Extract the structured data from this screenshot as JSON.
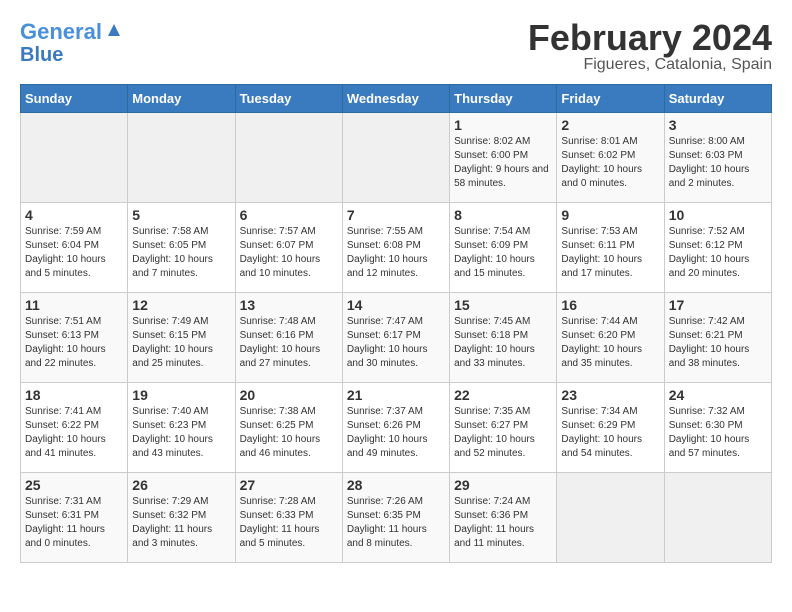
{
  "header": {
    "logo_line1": "General",
    "logo_line2": "Blue",
    "title": "February 2024",
    "subtitle": "Figueres, Catalonia, Spain"
  },
  "days_of_week": [
    "Sunday",
    "Monday",
    "Tuesday",
    "Wednesday",
    "Thursday",
    "Friday",
    "Saturday"
  ],
  "weeks": [
    [
      {
        "num": "",
        "info": ""
      },
      {
        "num": "",
        "info": ""
      },
      {
        "num": "",
        "info": ""
      },
      {
        "num": "",
        "info": ""
      },
      {
        "num": "1",
        "info": "Sunrise: 8:02 AM\nSunset: 6:00 PM\nDaylight: 9 hours and 58 minutes."
      },
      {
        "num": "2",
        "info": "Sunrise: 8:01 AM\nSunset: 6:02 PM\nDaylight: 10 hours and 0 minutes."
      },
      {
        "num": "3",
        "info": "Sunrise: 8:00 AM\nSunset: 6:03 PM\nDaylight: 10 hours and 2 minutes."
      }
    ],
    [
      {
        "num": "4",
        "info": "Sunrise: 7:59 AM\nSunset: 6:04 PM\nDaylight: 10 hours and 5 minutes."
      },
      {
        "num": "5",
        "info": "Sunrise: 7:58 AM\nSunset: 6:05 PM\nDaylight: 10 hours and 7 minutes."
      },
      {
        "num": "6",
        "info": "Sunrise: 7:57 AM\nSunset: 6:07 PM\nDaylight: 10 hours and 10 minutes."
      },
      {
        "num": "7",
        "info": "Sunrise: 7:55 AM\nSunset: 6:08 PM\nDaylight: 10 hours and 12 minutes."
      },
      {
        "num": "8",
        "info": "Sunrise: 7:54 AM\nSunset: 6:09 PM\nDaylight: 10 hours and 15 minutes."
      },
      {
        "num": "9",
        "info": "Sunrise: 7:53 AM\nSunset: 6:11 PM\nDaylight: 10 hours and 17 minutes."
      },
      {
        "num": "10",
        "info": "Sunrise: 7:52 AM\nSunset: 6:12 PM\nDaylight: 10 hours and 20 minutes."
      }
    ],
    [
      {
        "num": "11",
        "info": "Sunrise: 7:51 AM\nSunset: 6:13 PM\nDaylight: 10 hours and 22 minutes."
      },
      {
        "num": "12",
        "info": "Sunrise: 7:49 AM\nSunset: 6:15 PM\nDaylight: 10 hours and 25 minutes."
      },
      {
        "num": "13",
        "info": "Sunrise: 7:48 AM\nSunset: 6:16 PM\nDaylight: 10 hours and 27 minutes."
      },
      {
        "num": "14",
        "info": "Sunrise: 7:47 AM\nSunset: 6:17 PM\nDaylight: 10 hours and 30 minutes."
      },
      {
        "num": "15",
        "info": "Sunrise: 7:45 AM\nSunset: 6:18 PM\nDaylight: 10 hours and 33 minutes."
      },
      {
        "num": "16",
        "info": "Sunrise: 7:44 AM\nSunset: 6:20 PM\nDaylight: 10 hours and 35 minutes."
      },
      {
        "num": "17",
        "info": "Sunrise: 7:42 AM\nSunset: 6:21 PM\nDaylight: 10 hours and 38 minutes."
      }
    ],
    [
      {
        "num": "18",
        "info": "Sunrise: 7:41 AM\nSunset: 6:22 PM\nDaylight: 10 hours and 41 minutes."
      },
      {
        "num": "19",
        "info": "Sunrise: 7:40 AM\nSunset: 6:23 PM\nDaylight: 10 hours and 43 minutes."
      },
      {
        "num": "20",
        "info": "Sunrise: 7:38 AM\nSunset: 6:25 PM\nDaylight: 10 hours and 46 minutes."
      },
      {
        "num": "21",
        "info": "Sunrise: 7:37 AM\nSunset: 6:26 PM\nDaylight: 10 hours and 49 minutes."
      },
      {
        "num": "22",
        "info": "Sunrise: 7:35 AM\nSunset: 6:27 PM\nDaylight: 10 hours and 52 minutes."
      },
      {
        "num": "23",
        "info": "Sunrise: 7:34 AM\nSunset: 6:29 PM\nDaylight: 10 hours and 54 minutes."
      },
      {
        "num": "24",
        "info": "Sunrise: 7:32 AM\nSunset: 6:30 PM\nDaylight: 10 hours and 57 minutes."
      }
    ],
    [
      {
        "num": "25",
        "info": "Sunrise: 7:31 AM\nSunset: 6:31 PM\nDaylight: 11 hours and 0 minutes."
      },
      {
        "num": "26",
        "info": "Sunrise: 7:29 AM\nSunset: 6:32 PM\nDaylight: 11 hours and 3 minutes."
      },
      {
        "num": "27",
        "info": "Sunrise: 7:28 AM\nSunset: 6:33 PM\nDaylight: 11 hours and 5 minutes."
      },
      {
        "num": "28",
        "info": "Sunrise: 7:26 AM\nSunset: 6:35 PM\nDaylight: 11 hours and 8 minutes."
      },
      {
        "num": "29",
        "info": "Sunrise: 7:24 AM\nSunset: 6:36 PM\nDaylight: 11 hours and 11 minutes."
      },
      {
        "num": "",
        "info": ""
      },
      {
        "num": "",
        "info": ""
      }
    ]
  ]
}
